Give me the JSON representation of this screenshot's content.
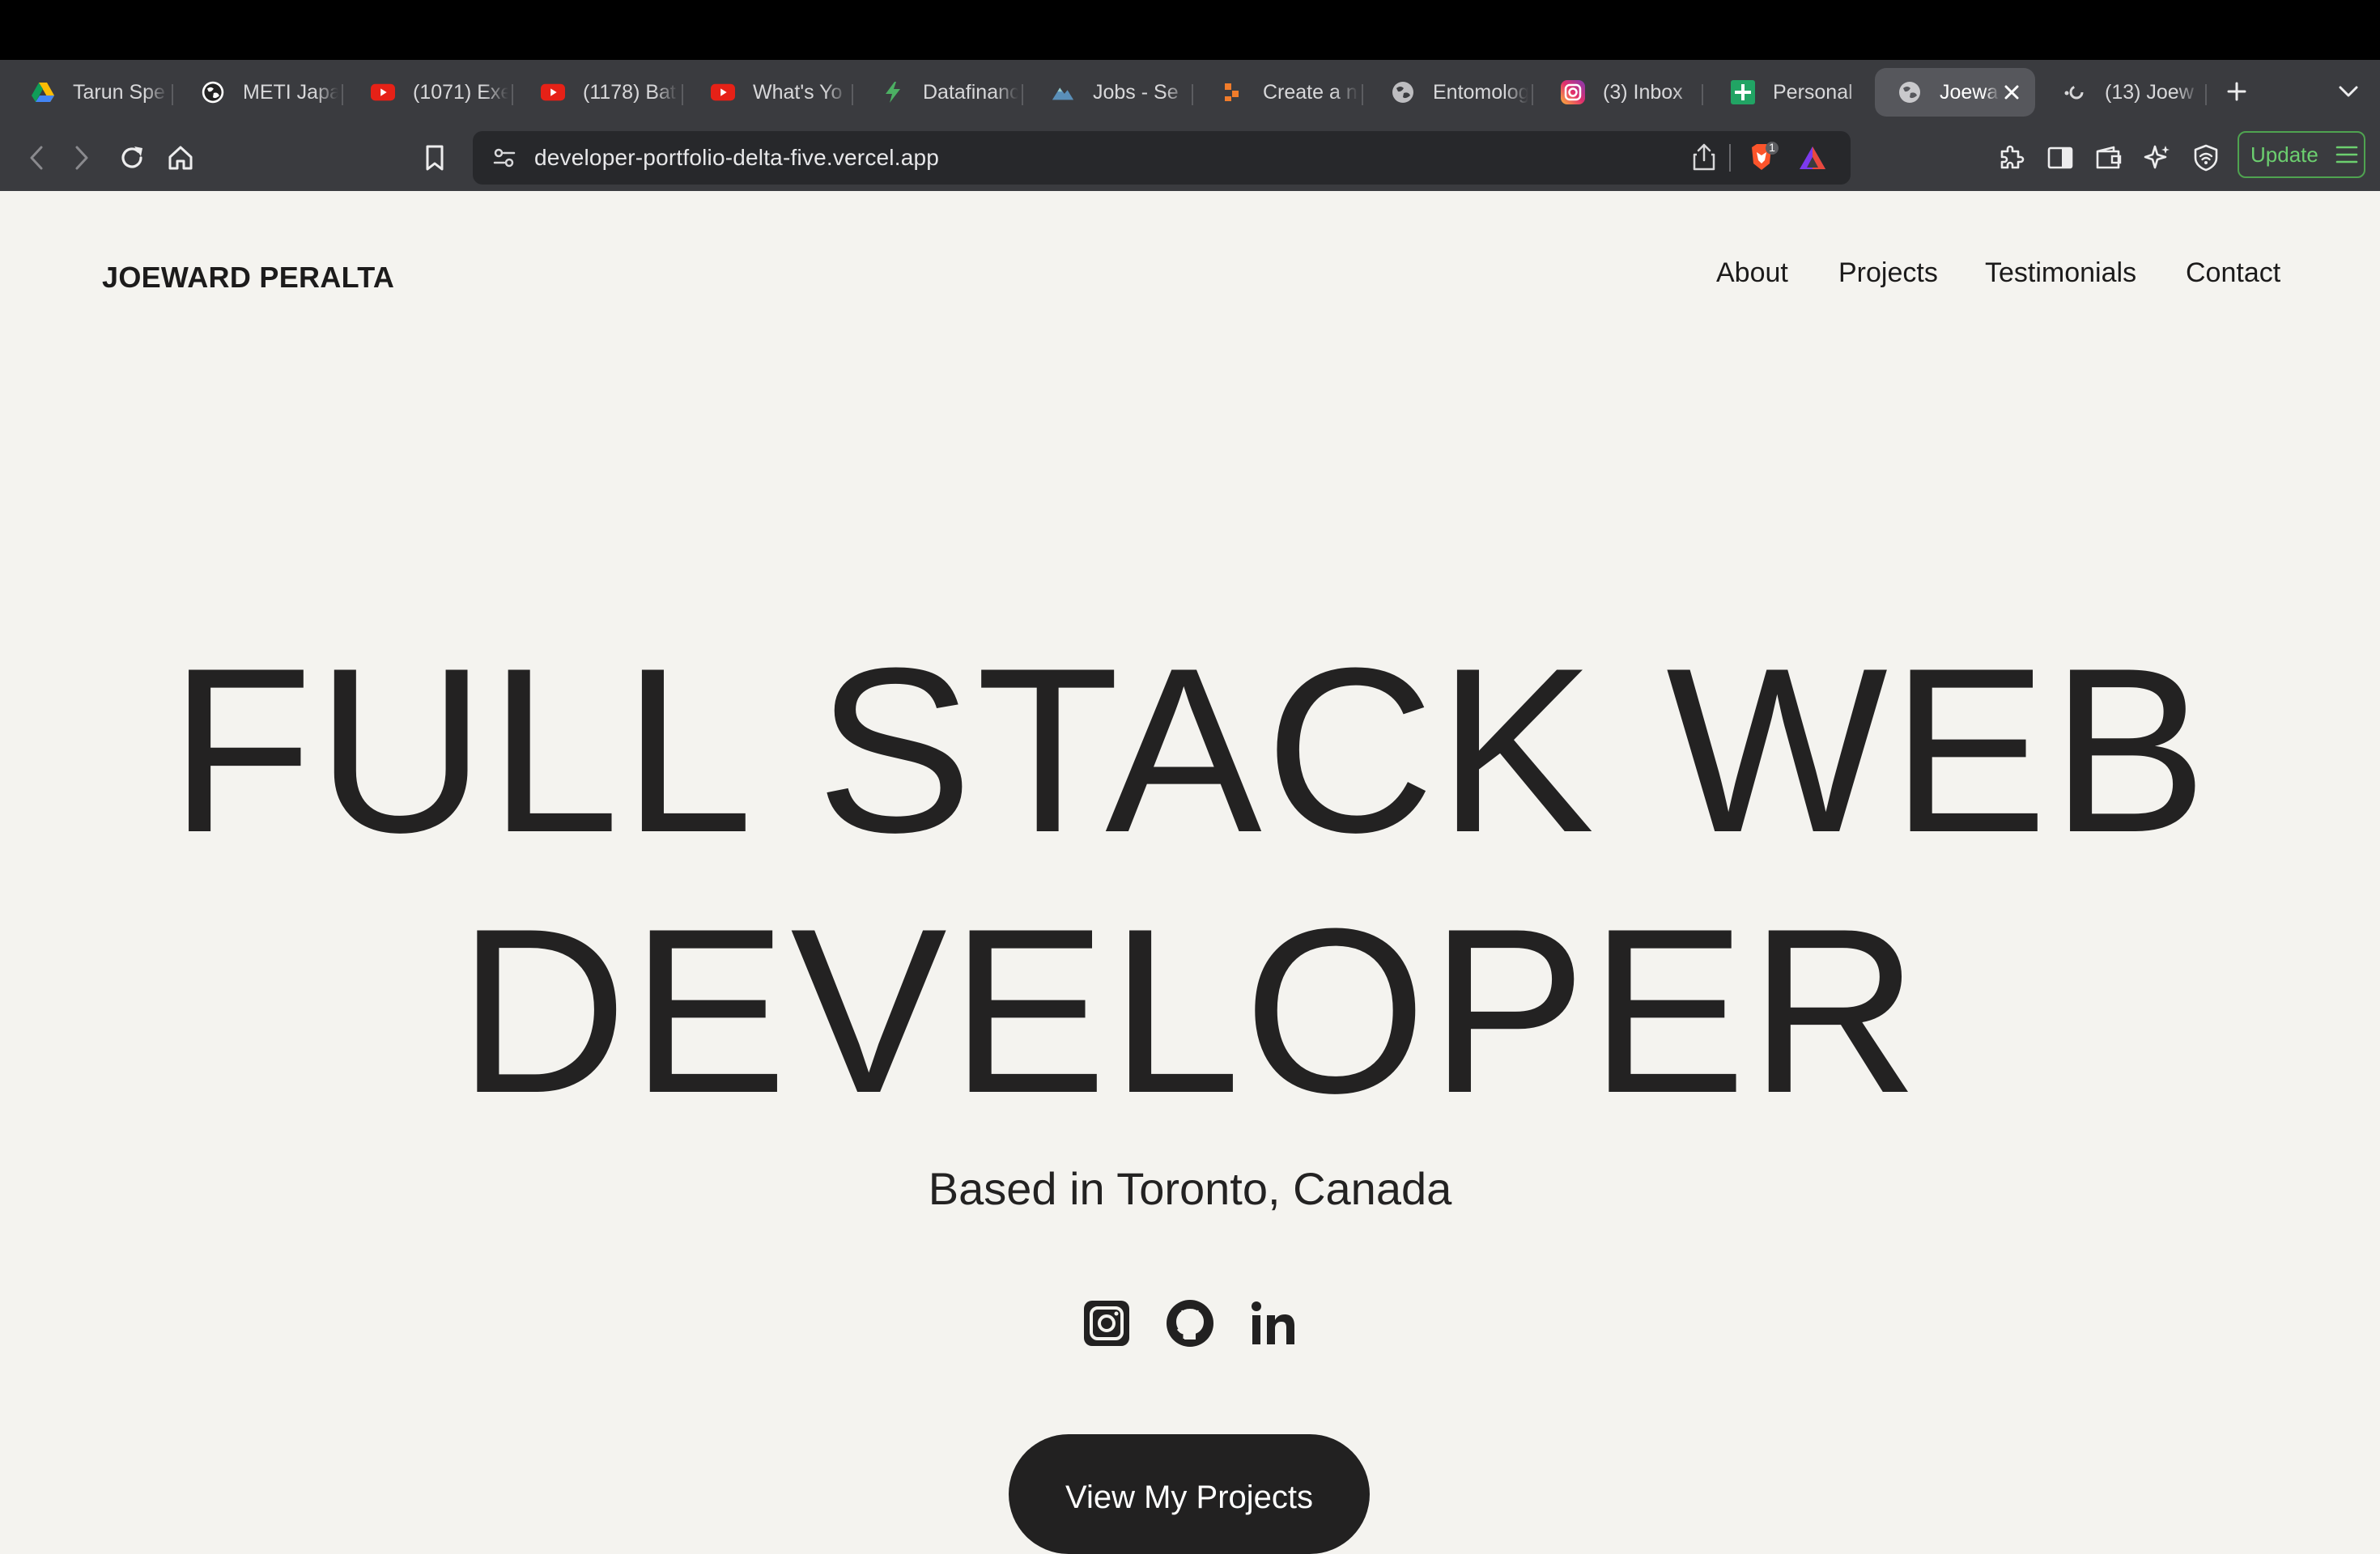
{
  "tabs": [
    {
      "title": "Tarun Spe",
      "icon": "google-drive-icon"
    },
    {
      "title": "METI Japa",
      "icon": "globe-icon"
    },
    {
      "title": "(1071) Exe",
      "icon": "youtube-icon"
    },
    {
      "title": "(1178) Bat",
      "icon": "youtube-icon"
    },
    {
      "title": "What's Yo",
      "icon": "youtube-icon"
    },
    {
      "title": "Datafinanc",
      "icon": "lightning-icon"
    },
    {
      "title": "Jobs - Se",
      "icon": "mountain-icon"
    },
    {
      "title": "Create a n",
      "icon": "blocks-icon"
    },
    {
      "title": "Entomolog",
      "icon": "globe-icon"
    },
    {
      "title": "(3) Inbox",
      "icon": "instagram-icon"
    },
    {
      "title": "Personal",
      "icon": "sheets-icon"
    },
    {
      "title": "Joewa",
      "icon": "globe-icon",
      "active": true
    },
    {
      "title": "(13) Joew",
      "icon": "loading-icon"
    }
  ],
  "toolbar": {
    "url": "developer-portfolio-delta-five.vercel.app",
    "brave_badge": "1",
    "update_label": "Update"
  },
  "site": {
    "logo": "JOEWARD PERALTA",
    "nav": [
      "About",
      "Projects",
      "Testimonials",
      "Contact"
    ],
    "hero_line1": "FULL STACK WEB",
    "hero_line2": "DEVELOPER",
    "subtitle": "Based in Toronto, Canada",
    "social": [
      "instagram-icon",
      "github-icon",
      "linkedin-icon"
    ],
    "cta": "View My Projects"
  },
  "colors": {
    "page_bg": "#f4f3ef",
    "text": "#232222",
    "chrome_bg": "#3a3b3f",
    "update_green": "#6ccf6f"
  }
}
